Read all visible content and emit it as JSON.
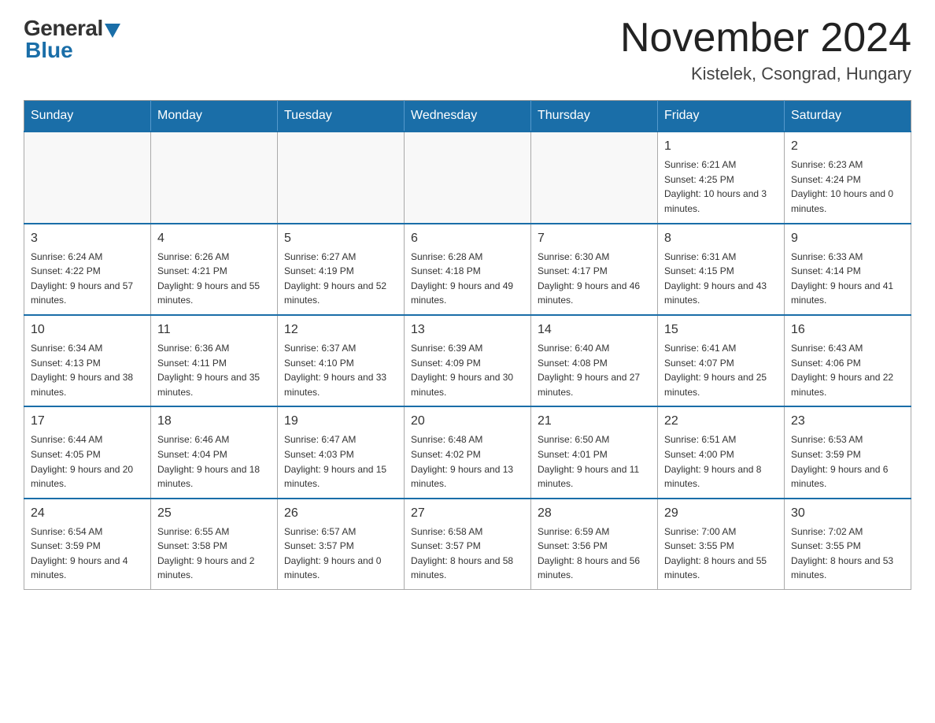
{
  "header": {
    "logo_general": "General",
    "logo_blue": "Blue",
    "month_title": "November 2024",
    "location": "Kistelek, Csongrad, Hungary"
  },
  "weekdays": [
    "Sunday",
    "Monday",
    "Tuesday",
    "Wednesday",
    "Thursday",
    "Friday",
    "Saturday"
  ],
  "weeks": [
    [
      {
        "day": "",
        "sunrise": "",
        "sunset": "",
        "daylight": ""
      },
      {
        "day": "",
        "sunrise": "",
        "sunset": "",
        "daylight": ""
      },
      {
        "day": "",
        "sunrise": "",
        "sunset": "",
        "daylight": ""
      },
      {
        "day": "",
        "sunrise": "",
        "sunset": "",
        "daylight": ""
      },
      {
        "day": "",
        "sunrise": "",
        "sunset": "",
        "daylight": ""
      },
      {
        "day": "1",
        "sunrise": "Sunrise: 6:21 AM",
        "sunset": "Sunset: 4:25 PM",
        "daylight": "Daylight: 10 hours and 3 minutes."
      },
      {
        "day": "2",
        "sunrise": "Sunrise: 6:23 AM",
        "sunset": "Sunset: 4:24 PM",
        "daylight": "Daylight: 10 hours and 0 minutes."
      }
    ],
    [
      {
        "day": "3",
        "sunrise": "Sunrise: 6:24 AM",
        "sunset": "Sunset: 4:22 PM",
        "daylight": "Daylight: 9 hours and 57 minutes."
      },
      {
        "day": "4",
        "sunrise": "Sunrise: 6:26 AM",
        "sunset": "Sunset: 4:21 PM",
        "daylight": "Daylight: 9 hours and 55 minutes."
      },
      {
        "day": "5",
        "sunrise": "Sunrise: 6:27 AM",
        "sunset": "Sunset: 4:19 PM",
        "daylight": "Daylight: 9 hours and 52 minutes."
      },
      {
        "day": "6",
        "sunrise": "Sunrise: 6:28 AM",
        "sunset": "Sunset: 4:18 PM",
        "daylight": "Daylight: 9 hours and 49 minutes."
      },
      {
        "day": "7",
        "sunrise": "Sunrise: 6:30 AM",
        "sunset": "Sunset: 4:17 PM",
        "daylight": "Daylight: 9 hours and 46 minutes."
      },
      {
        "day": "8",
        "sunrise": "Sunrise: 6:31 AM",
        "sunset": "Sunset: 4:15 PM",
        "daylight": "Daylight: 9 hours and 43 minutes."
      },
      {
        "day": "9",
        "sunrise": "Sunrise: 6:33 AM",
        "sunset": "Sunset: 4:14 PM",
        "daylight": "Daylight: 9 hours and 41 minutes."
      }
    ],
    [
      {
        "day": "10",
        "sunrise": "Sunrise: 6:34 AM",
        "sunset": "Sunset: 4:13 PM",
        "daylight": "Daylight: 9 hours and 38 minutes."
      },
      {
        "day": "11",
        "sunrise": "Sunrise: 6:36 AM",
        "sunset": "Sunset: 4:11 PM",
        "daylight": "Daylight: 9 hours and 35 minutes."
      },
      {
        "day": "12",
        "sunrise": "Sunrise: 6:37 AM",
        "sunset": "Sunset: 4:10 PM",
        "daylight": "Daylight: 9 hours and 33 minutes."
      },
      {
        "day": "13",
        "sunrise": "Sunrise: 6:39 AM",
        "sunset": "Sunset: 4:09 PM",
        "daylight": "Daylight: 9 hours and 30 minutes."
      },
      {
        "day": "14",
        "sunrise": "Sunrise: 6:40 AM",
        "sunset": "Sunset: 4:08 PM",
        "daylight": "Daylight: 9 hours and 27 minutes."
      },
      {
        "day": "15",
        "sunrise": "Sunrise: 6:41 AM",
        "sunset": "Sunset: 4:07 PM",
        "daylight": "Daylight: 9 hours and 25 minutes."
      },
      {
        "day": "16",
        "sunrise": "Sunrise: 6:43 AM",
        "sunset": "Sunset: 4:06 PM",
        "daylight": "Daylight: 9 hours and 22 minutes."
      }
    ],
    [
      {
        "day": "17",
        "sunrise": "Sunrise: 6:44 AM",
        "sunset": "Sunset: 4:05 PM",
        "daylight": "Daylight: 9 hours and 20 minutes."
      },
      {
        "day": "18",
        "sunrise": "Sunrise: 6:46 AM",
        "sunset": "Sunset: 4:04 PM",
        "daylight": "Daylight: 9 hours and 18 minutes."
      },
      {
        "day": "19",
        "sunrise": "Sunrise: 6:47 AM",
        "sunset": "Sunset: 4:03 PM",
        "daylight": "Daylight: 9 hours and 15 minutes."
      },
      {
        "day": "20",
        "sunrise": "Sunrise: 6:48 AM",
        "sunset": "Sunset: 4:02 PM",
        "daylight": "Daylight: 9 hours and 13 minutes."
      },
      {
        "day": "21",
        "sunrise": "Sunrise: 6:50 AM",
        "sunset": "Sunset: 4:01 PM",
        "daylight": "Daylight: 9 hours and 11 minutes."
      },
      {
        "day": "22",
        "sunrise": "Sunrise: 6:51 AM",
        "sunset": "Sunset: 4:00 PM",
        "daylight": "Daylight: 9 hours and 8 minutes."
      },
      {
        "day": "23",
        "sunrise": "Sunrise: 6:53 AM",
        "sunset": "Sunset: 3:59 PM",
        "daylight": "Daylight: 9 hours and 6 minutes."
      }
    ],
    [
      {
        "day": "24",
        "sunrise": "Sunrise: 6:54 AM",
        "sunset": "Sunset: 3:59 PM",
        "daylight": "Daylight: 9 hours and 4 minutes."
      },
      {
        "day": "25",
        "sunrise": "Sunrise: 6:55 AM",
        "sunset": "Sunset: 3:58 PM",
        "daylight": "Daylight: 9 hours and 2 minutes."
      },
      {
        "day": "26",
        "sunrise": "Sunrise: 6:57 AM",
        "sunset": "Sunset: 3:57 PM",
        "daylight": "Daylight: 9 hours and 0 minutes."
      },
      {
        "day": "27",
        "sunrise": "Sunrise: 6:58 AM",
        "sunset": "Sunset: 3:57 PM",
        "daylight": "Daylight: 8 hours and 58 minutes."
      },
      {
        "day": "28",
        "sunrise": "Sunrise: 6:59 AM",
        "sunset": "Sunset: 3:56 PM",
        "daylight": "Daylight: 8 hours and 56 minutes."
      },
      {
        "day": "29",
        "sunrise": "Sunrise: 7:00 AM",
        "sunset": "Sunset: 3:55 PM",
        "daylight": "Daylight: 8 hours and 55 minutes."
      },
      {
        "day": "30",
        "sunrise": "Sunrise: 7:02 AM",
        "sunset": "Sunset: 3:55 PM",
        "daylight": "Daylight: 8 hours and 53 minutes."
      }
    ]
  ]
}
